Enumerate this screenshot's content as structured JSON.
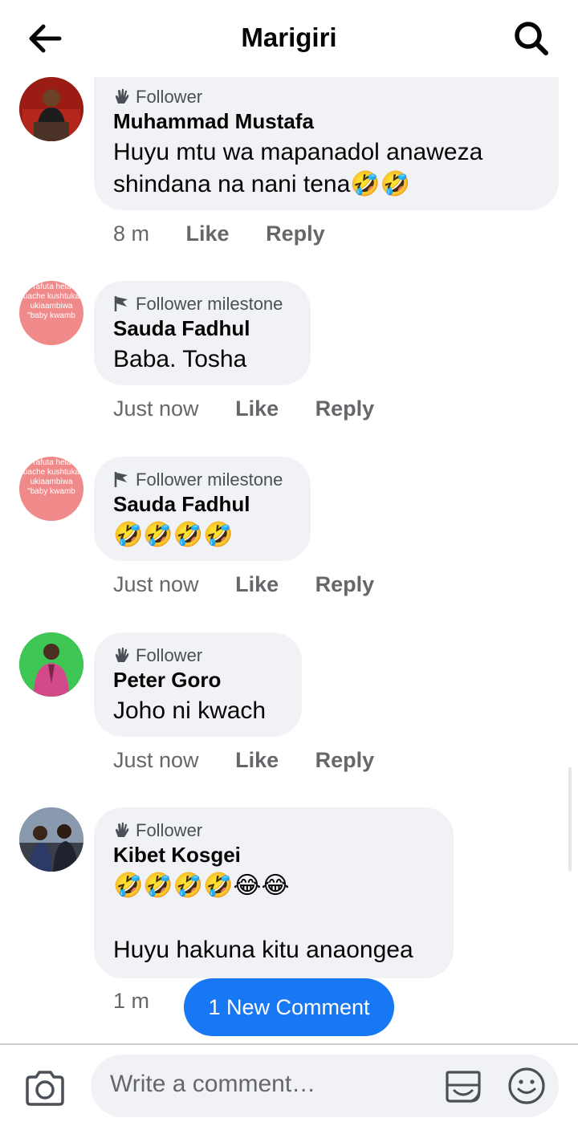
{
  "header": {
    "title": "Marigiri"
  },
  "comments": [
    {
      "badge": "Follower",
      "name": "Muhammad Mustafa",
      "text": "Huyu mtu wa mapanadol anaweza\nshindana na nani tena🤣🤣",
      "time": "8 m",
      "like": "Like",
      "reply": "Reply"
    },
    {
      "badge": "Follower milestone",
      "name": "Sauda Fadhul",
      "text": "Baba. Tosha",
      "time": "Just now",
      "like": "Like",
      "reply": "Reply",
      "avatar_text": "Tafuta hela uache kushtuka ukiaambiwa \"baby kwamb"
    },
    {
      "badge": "Follower milestone",
      "name": "Sauda Fadhul",
      "text": "🤣🤣🤣🤣",
      "time": "Just now",
      "like": "Like",
      "reply": "Reply",
      "avatar_text": "Tafuta hela uache kushtuka ukiaambiwa \"baby kwamb"
    },
    {
      "badge": "Follower",
      "name": "Peter Goro",
      "text": "Joho ni kwach",
      "time": "Just now",
      "like": "Like",
      "reply": "Reply"
    },
    {
      "badge": "Follower",
      "name": "Kibet Kosgei",
      "text": "🤣🤣🤣🤣😂😂\n\nHuyu hakuna kitu anaongea",
      "time": "1 m"
    }
  ],
  "new_comment_label": "1 New Comment",
  "composer": {
    "placeholder": "Write a comment…"
  },
  "icons": {
    "back": "arrow-left-icon",
    "search": "search-icon",
    "camera": "camera-icon",
    "gif": "sticker-icon",
    "emoji": "smile-icon",
    "follower": "wave-hand-icon",
    "milestone": "flag-icon"
  },
  "colors": {
    "accent": "#1877f2",
    "bubble": "#f0f2f5",
    "muted": "#65676b"
  }
}
